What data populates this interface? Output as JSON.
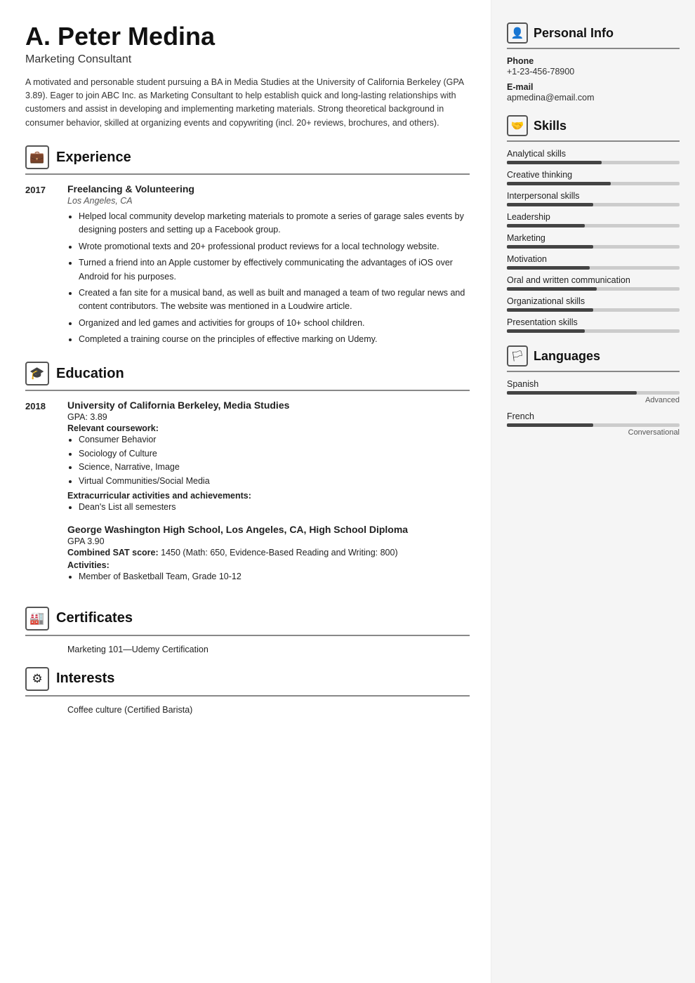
{
  "header": {
    "name": "A. Peter Medina",
    "job_title": "Marketing Consultant",
    "summary": "A motivated and personable student pursuing a BA in Media Studies at the University of California Berkeley (GPA 3.89). Eager to join ABC Inc. as Marketing Consultant to help establish quick and long-lasting relationships with customers and assist in developing and implementing marketing materials. Strong theoretical background in consumer behavior, skilled at organizing events and copywriting (incl. 20+ reviews, brochures, and others)."
  },
  "sections": {
    "experience": {
      "title": "Experience",
      "entries": [
        {
          "year": "2017",
          "title": "Freelancing & Volunteering",
          "subtitle": "Los Angeles, CA",
          "bullets": [
            "Helped local community develop marketing materials to promote a series of garage sales events by designing posters and setting up a Facebook group.",
            "Wrote promotional texts and 20+ professional product reviews for a local technology website.",
            "Turned a friend into an Apple customer by effectively communicating the advantages of iOS over Android for his purposes.",
            "Created a fan site for a musical band, as well as built and managed a team of two regular news and content contributors. The website was mentioned in a Loudwire article.",
            "Organized and led games and activities for groups of 10+ school children.",
            "Completed a training course on the principles of effective marking on Udemy."
          ]
        }
      ]
    },
    "education": {
      "title": "Education",
      "entries": [
        {
          "year": "2018",
          "schools": [
            {
              "title": "University of California Berkeley, Media Studies",
              "gpa": "GPA: 3.89",
              "coursework_label": "Relevant coursework:",
              "coursework": [
                "Consumer Behavior",
                "Sociology of Culture",
                "Science, Narrative, Image",
                "Virtual Communities/Social Media"
              ],
              "activities_label": "Extracurricular activities and achievements:",
              "activities": [
                "Dean's List all semesters"
              ]
            },
            {
              "title": "George Washington High School, Los Angeles, CA, High School Diploma",
              "gpa": "GPA 3.90",
              "sat_label": "Combined SAT score:",
              "sat_value": "1450 (Math: 650, Evidence-Based Reading and Writing: 800)",
              "activities_label": "Activities:",
              "activities": [
                "Member of Basketball Team, Grade 10-12"
              ]
            }
          ]
        }
      ]
    },
    "certificates": {
      "title": "Certificates",
      "items": [
        "Marketing 101—Udemy Certification"
      ]
    },
    "interests": {
      "title": "Interests",
      "items": [
        "Coffee culture (Certified Barista)"
      ]
    }
  },
  "sidebar": {
    "personal_info": {
      "title": "Personal Info",
      "phone_label": "Phone",
      "phone_value": "+1-23-456-78900",
      "email_label": "E-mail",
      "email_value": "apmedina@email.com"
    },
    "skills": {
      "title": "Skills",
      "items": [
        {
          "name": "Analytical skills",
          "level": 55
        },
        {
          "name": "Creative thinking",
          "level": 60
        },
        {
          "name": "Interpersonal skills",
          "level": 50
        },
        {
          "name": "Leadership",
          "level": 45
        },
        {
          "name": "Marketing",
          "level": 50
        },
        {
          "name": "Motivation",
          "level": 48
        },
        {
          "name": "Oral and written communication",
          "level": 52
        },
        {
          "name": "Organizational skills",
          "level": 50
        },
        {
          "name": "Presentation skills",
          "level": 45
        }
      ]
    },
    "languages": {
      "title": "Languages",
      "items": [
        {
          "name": "Spanish",
          "level": 75,
          "label": "Advanced"
        },
        {
          "name": "French",
          "level": 50,
          "label": "Conversational"
        }
      ]
    }
  },
  "icons": {
    "experience": "💼",
    "education": "🎓",
    "certificates": "🏅",
    "interests": "🎯",
    "personal_info": "👤",
    "skills": "🤝",
    "languages": "🚩"
  }
}
